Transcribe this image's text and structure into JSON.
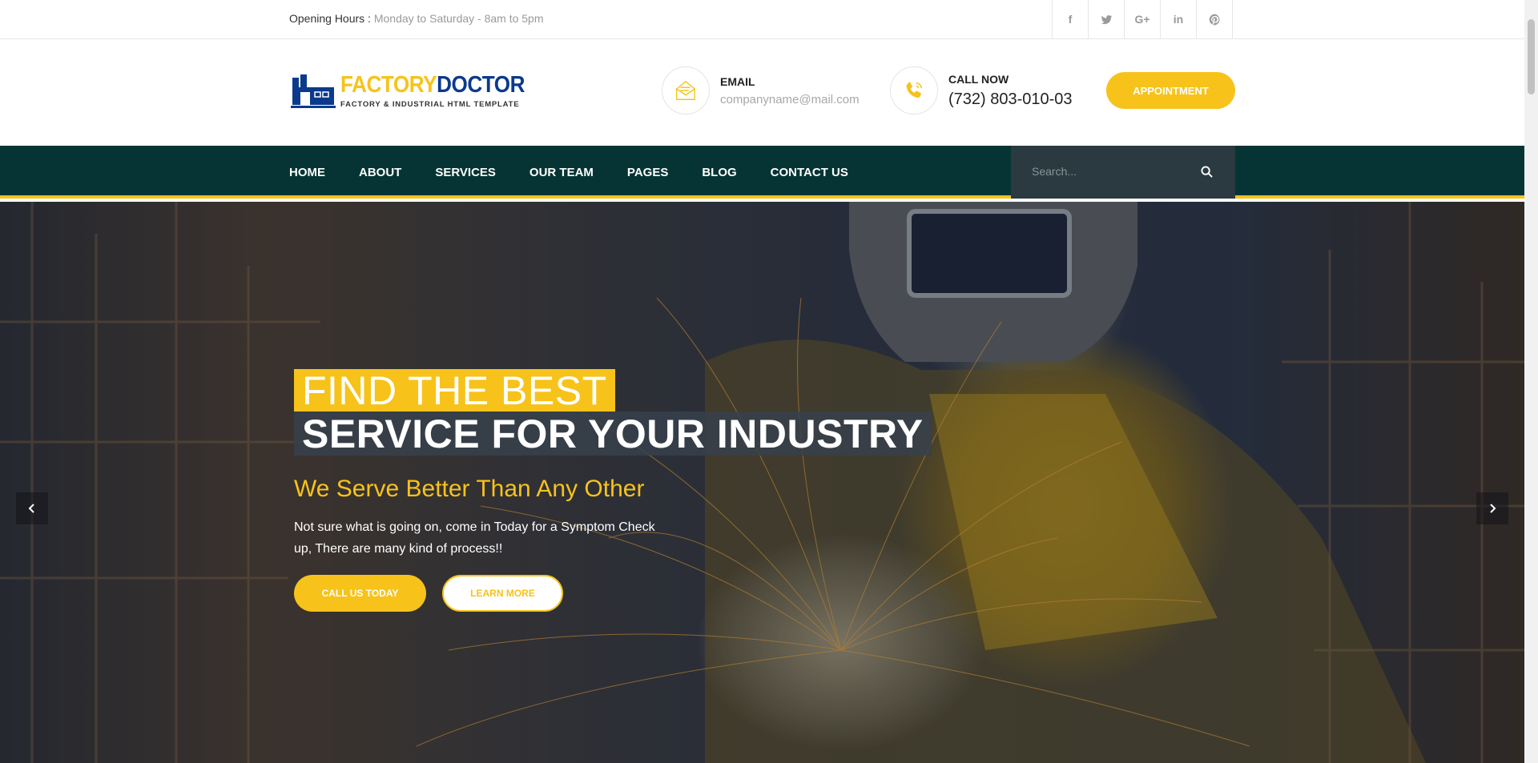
{
  "topbar": {
    "hours_label": "Opening Hours :",
    "hours_value": "Monday to Saturday - 8am to 5pm",
    "social": [
      {
        "icon": "facebook-icon",
        "glyph": "f"
      },
      {
        "icon": "twitter-icon",
        "glyph": ""
      },
      {
        "icon": "google-plus-icon",
        "glyph": "G+"
      },
      {
        "icon": "linkedin-icon",
        "glyph": "in"
      },
      {
        "icon": "pinterest-icon",
        "glyph": ""
      }
    ]
  },
  "header": {
    "logo_part1": "FACTORY",
    "logo_part2": "DOCTOR",
    "logo_tagline": "FACTORY & INDUSTRIAL HTML TEMPLATE",
    "email_label": "EMAIL",
    "email_value": "companyname@mail.com",
    "phone_label": "CALL NOW",
    "phone_value": "(732) 803-010-03",
    "appointment_label": "APPOINTMENT"
  },
  "nav": {
    "items": [
      {
        "label": "HOME"
      },
      {
        "label": "ABOUT"
      },
      {
        "label": "SERVICES"
      },
      {
        "label": "OUR TEAM"
      },
      {
        "label": "PAGES"
      },
      {
        "label": "BLOG"
      },
      {
        "label": "CONTACT US"
      }
    ],
    "search_placeholder": "Search..."
  },
  "hero": {
    "title_line1": "FIND THE BEST",
    "title_line2": "SERVICE FOR YOUR INDUSTRY",
    "subtitle": "We Serve Better Than Any Other",
    "description": "Not sure what is going on, come in Today for a Symptom Check up, There are many kind of process!!",
    "cta_primary": "CALL US TODAY",
    "cta_secondary": "LEARN MORE"
  },
  "colors": {
    "accent": "#f7c31a",
    "nav_bg": "#063434",
    "brand_blue": "#0b3a8c"
  }
}
